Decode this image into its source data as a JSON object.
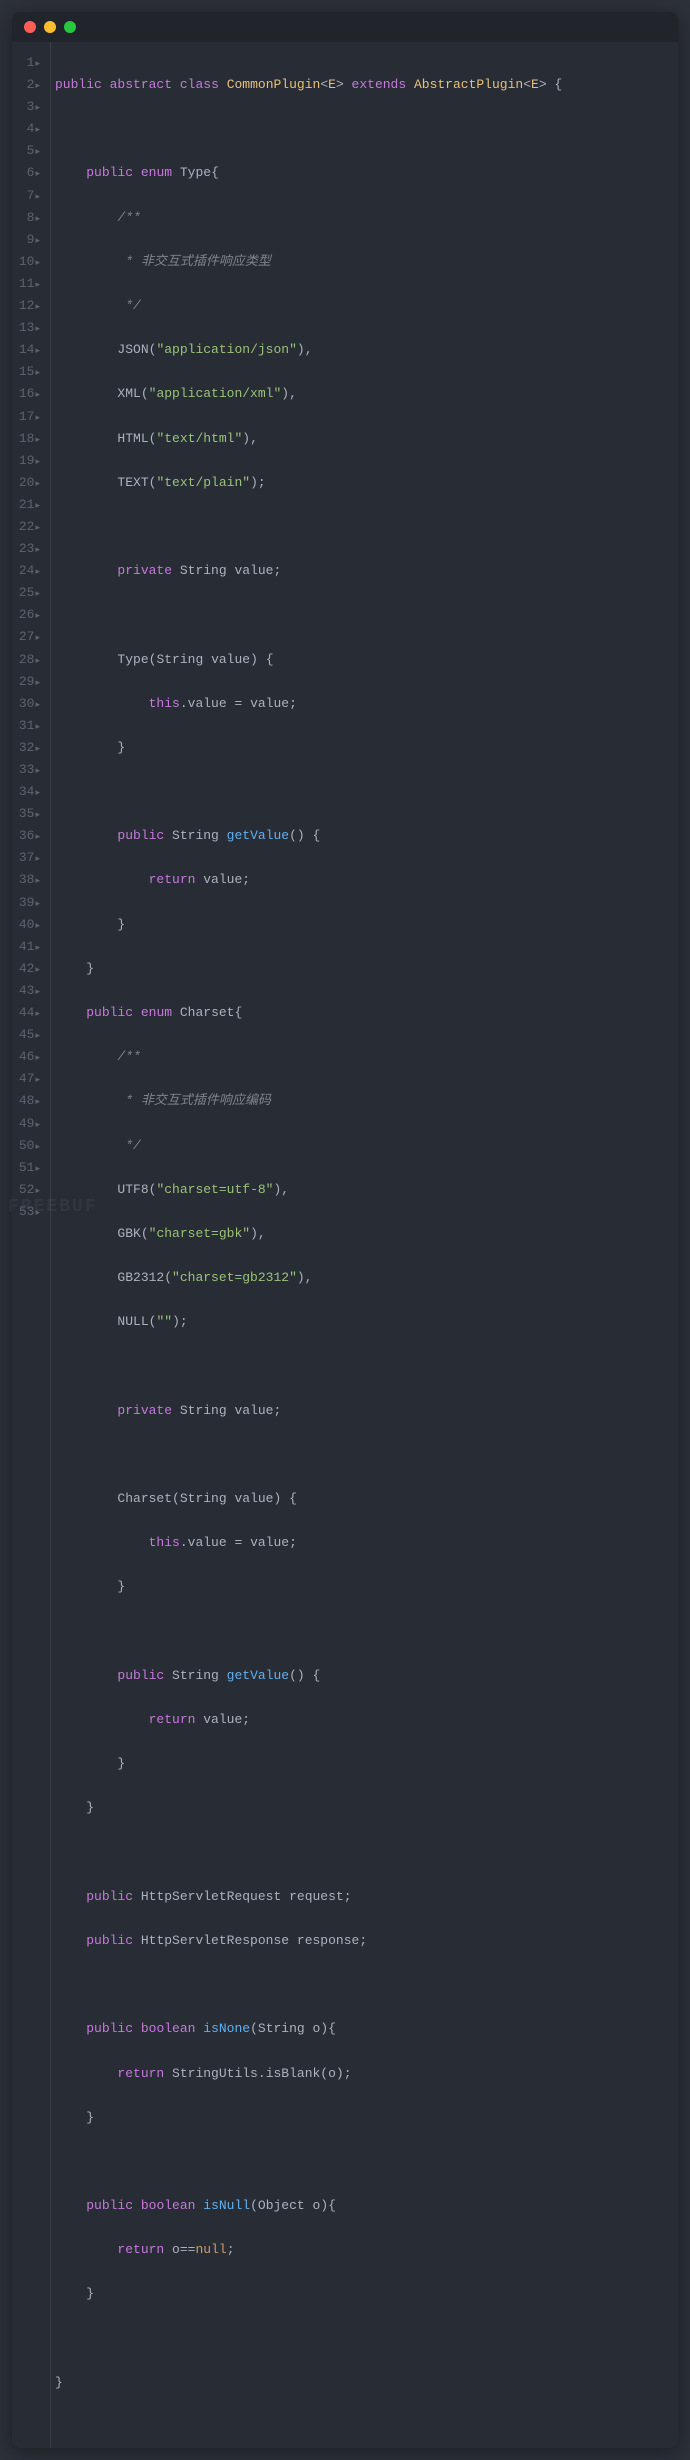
{
  "window": {
    "title": ""
  },
  "tokens": {
    "kw_public": "public",
    "kw_abstract": "abstract",
    "kw_class": "class",
    "kw_extends": "extends",
    "kw_enum": "enum",
    "kw_private": "private",
    "kw_this": "this",
    "kw_return": "return",
    "kw_boolean": "boolean",
    "kw_null": "null",
    "cls_CommonPlugin": "CommonPlugin",
    "cls_AbstractPlugin": "AbstractPlugin",
    "cls_E": "E",
    "id_Type": "Type",
    "id_Charset": "Charset",
    "id_String": "String",
    "id_value": "value",
    "id_Object": "Object",
    "id_o": "o",
    "id_request": "request",
    "id_response": "response",
    "id_HttpServletRequest": "HttpServletRequest",
    "id_HttpServletResponse": "HttpServletResponse",
    "id_StringUtils": "StringUtils",
    "id_isBlank": "isBlank",
    "fn_getValue": "getValue",
    "fn_isNone": "isNone",
    "fn_isNull": "isNull",
    "enum_JSON": "JSON",
    "enum_XML": "XML",
    "enum_HTML": "HTML",
    "enum_TEXT": "TEXT",
    "enum_UTF8": "UTF8",
    "enum_GBK": "GBK",
    "enum_GB2312": "GB2312",
    "enum_NULL": "NULL",
    "str_json": "\"application/json\"",
    "str_xml": "\"application/xml\"",
    "str_html": "\"text/html\"",
    "str_text": "\"text/plain\"",
    "str_utf8": "\"charset=utf-8\"",
    "str_gbk": "\"charset=gbk\"",
    "str_gb2312": "\"charset=gb2312\"",
    "str_empty": "\"\"",
    "cmt_open": "/**",
    "cmt_type": " * 非交互式插件响应类型",
    "cmt_charset": " * 非交互式插件响应编码",
    "cmt_close": " */"
  },
  "lines": [
    1,
    2,
    3,
    4,
    5,
    6,
    7,
    8,
    9,
    10,
    11,
    12,
    13,
    14,
    15,
    16,
    17,
    18,
    19,
    20,
    21,
    22,
    23,
    24,
    25,
    26,
    27,
    28,
    29,
    30,
    31,
    32,
    33,
    34,
    35,
    36,
    37,
    38,
    39,
    40,
    41,
    42,
    43,
    44,
    45,
    46,
    47,
    48,
    49,
    50,
    51,
    52,
    53
  ],
  "watermark": "FREEBUF"
}
